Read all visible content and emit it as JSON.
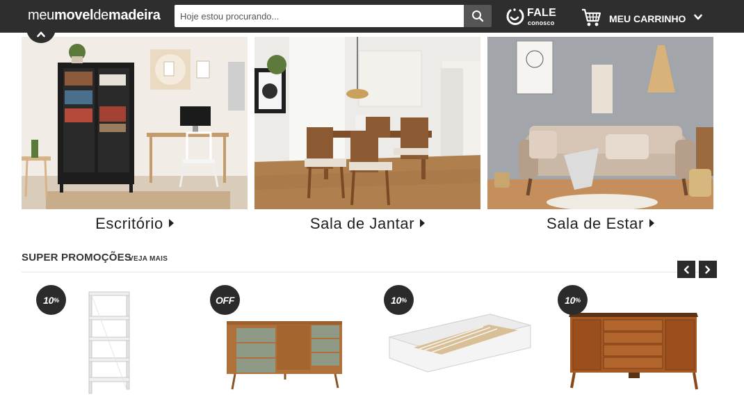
{
  "header": {
    "logo": {
      "part1": "meu",
      "part2": "movel",
      "part3": "de",
      "part4": "madeira"
    },
    "search": {
      "placeholder": "Hoje estou procurando..."
    },
    "contact": {
      "line1": "FALE",
      "line2": "conosco"
    },
    "cart": {
      "label": "MEU CARRINHO"
    }
  },
  "categories": [
    {
      "label": "Escritório"
    },
    {
      "label": "Sala de Jantar"
    },
    {
      "label": "Sala de Estar"
    }
  ],
  "promotions": {
    "title": "SUPER PROMOÇÕES",
    "more": "VEJA MAIS",
    "products": [
      {
        "badge_main": "10",
        "badge_suffix": "%"
      },
      {
        "badge_main": "OFF",
        "badge_suffix": ""
      },
      {
        "badge_main": "10",
        "badge_suffix": "%"
      },
      {
        "badge_main": "10",
        "badge_suffix": "%"
      }
    ]
  },
  "colors": {
    "header_bg": "#2e2e2e",
    "badge_bg": "#2b2b2b",
    "accent_wood": "#b0703a",
    "sage_green": "#8e9a86"
  },
  "icons": [
    "search-icon",
    "smile-icon",
    "cart-icon",
    "chevron-down-icon",
    "chevron-up-icon",
    "chevron-left-icon",
    "chevron-right-icon"
  ]
}
